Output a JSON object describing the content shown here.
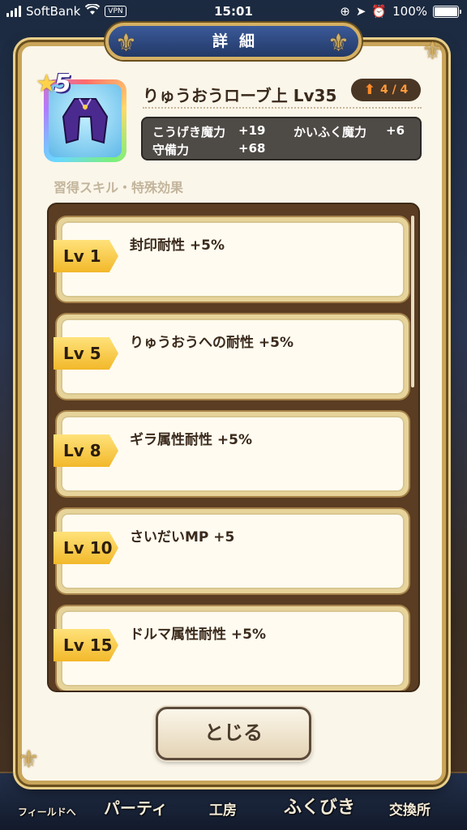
{
  "status_bar": {
    "carrier": "SoftBank",
    "vpn": "VPN",
    "time": "15:01",
    "battery": "100%"
  },
  "dialog": {
    "title": "詳細",
    "item": {
      "rarity": "5",
      "name": "りゅうおうローブ上 Lv35",
      "upgrade": "4 / 4",
      "stats": [
        {
          "label": "こうげき魔力",
          "value": "+19"
        },
        {
          "label": "かいふく魔力",
          "value": "+6"
        },
        {
          "label": "守備力",
          "value": "+68"
        }
      ]
    },
    "section_label": "習得スキル・特殊効果",
    "skills": [
      {
        "level": "Lv 1",
        "text": "封印耐性 +5%"
      },
      {
        "level": "Lv 5",
        "text": "りゅうおうへの耐性 +5%"
      },
      {
        "level": "Lv 8",
        "text": "ギラ属性耐性 +5%"
      },
      {
        "level": "Lv 10",
        "text": "さいだいMP +5"
      },
      {
        "level": "Lv 15",
        "text": "ドルマ属性耐性 +5%"
      }
    ],
    "close_label": "とじる"
  },
  "bottom_nav": [
    "フィールドへ",
    "パーティ",
    "工房",
    "ふくびき",
    "交換所"
  ]
}
